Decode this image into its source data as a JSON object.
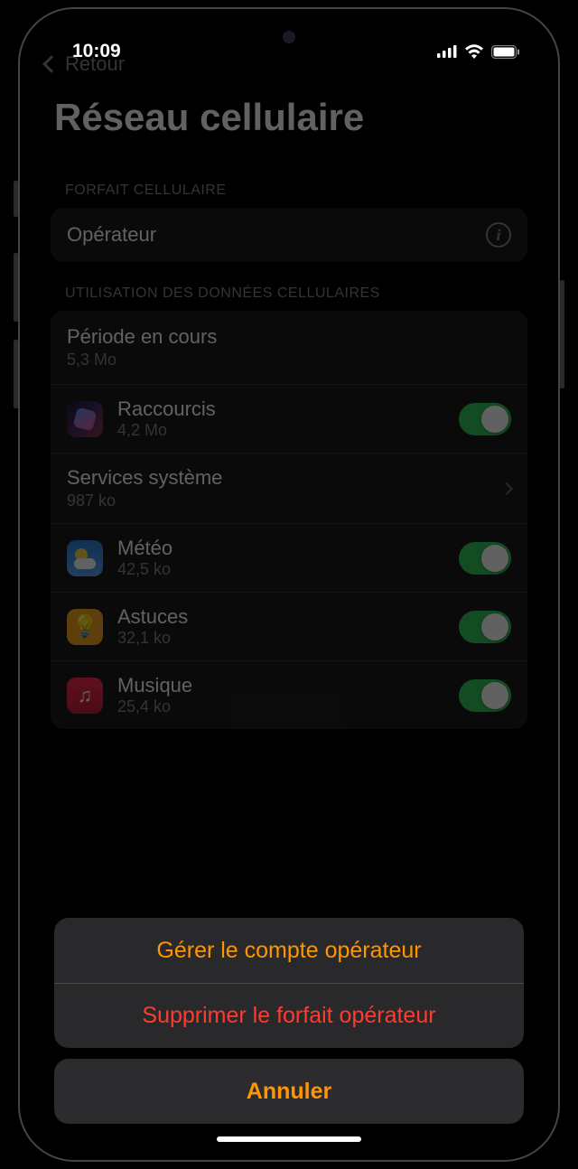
{
  "statusBar": {
    "time": "10:09"
  },
  "nav": {
    "back": "Retour"
  },
  "title": "Réseau cellulaire",
  "planSection": {
    "header": "FORFAIT CELLULAIRE",
    "carrier": "Opérateur"
  },
  "usageSection": {
    "header": "UTILISATION DES DONNÉES CELLULAIRES",
    "period": {
      "label": "Période en cours",
      "value": "5,3 Mo"
    },
    "services": {
      "label": "Services système",
      "value": "987 ko"
    },
    "apps": [
      {
        "name": "Raccourcis",
        "data": "4,2 Mo",
        "icon": "shortcuts"
      },
      {
        "name": "Météo",
        "data": "42,5 ko",
        "icon": "weather"
      },
      {
        "name": "Astuces",
        "data": "32,1 ko",
        "icon": "tips"
      },
      {
        "name": "Musique",
        "data": "25,4 ko",
        "icon": "music"
      }
    ]
  },
  "actionSheet": {
    "manage": "Gérer le compte opérateur",
    "remove": "Supprimer le forfait opérateur",
    "cancel": "Annuler"
  }
}
